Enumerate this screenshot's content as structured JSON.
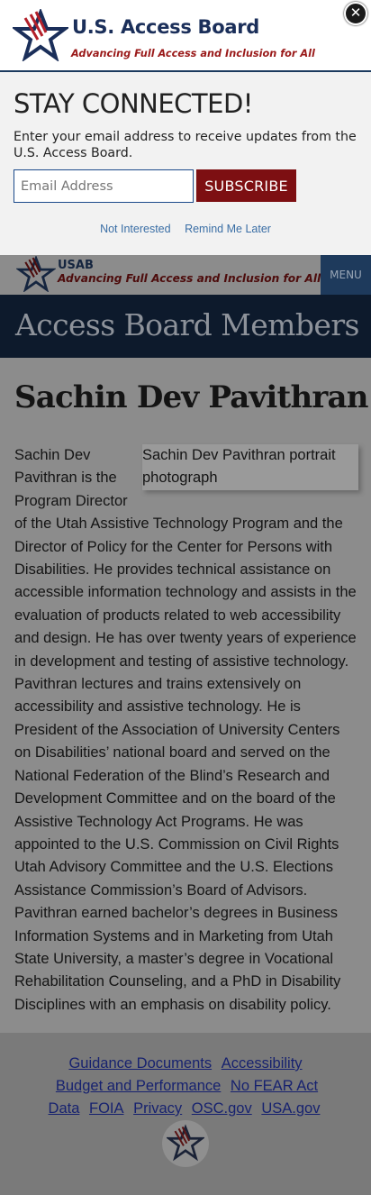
{
  "modal": {
    "brand": "U.S. Access Board",
    "tagline": "Advancing Full Access and Inclusion for All",
    "close_label": "✕",
    "title": "STAY CONNECTED!",
    "description": "Enter your email address to receive updates from the U.S. Access Board.",
    "email_placeholder": "Email Address",
    "subscribe_label": "SUBSCRIBE",
    "not_interested": "Not Interested",
    "remind_later": "Remind Me Later"
  },
  "header": {
    "short_name": "USAB",
    "tagline": "Advancing Full Access and Inclusion for All",
    "menu_label": "MENU"
  },
  "banner": {
    "title": "Access Board Members"
  },
  "member": {
    "name": "Sachin Dev Pavithran",
    "portrait_alt": "Sachin Dev Pavithran portrait photograph",
    "bio": "Sachin Dev Pavithran is the Program Director of the Utah Assistive Technology Program and the Director of Policy for the Center for Persons with Disabilities. He provides technical assistance on accessible information technology and assists in the evaluation of products related to web accessibility and design. He has over twenty years of experience in development and testing of assistive technology. Pavithran lectures and trains extensively on accessibility and assistive technology. He is President of the Association of University Centers on Disabilities’ national board and served on the National Federation of the Blind’s Research and Development Committee and on the board of the Assistive Technology Act Programs. He was appointed to the U.S. Commission on Civil Rights Utah Advisory Committee and the U.S. Elections Assistance Commission’s Board of Advisors. Pavithran earned bachelor’s degrees in Business Information Systems and in Marketing from Utah State University, a master’s degree in Vocational Rehabilitation Counseling, and a PhD in Disability Disciplines with an emphasis on disability policy."
  },
  "footer": {
    "links": [
      "Guidance Documents",
      "Accessibility",
      "Budget and Performance",
      "No FEAR Act Data",
      "FOIA",
      "Privacy",
      "OSC.gov",
      "USA.gov"
    ]
  },
  "colors": {
    "brand_navy": "#1b2f5a",
    "brand_red": "#9a1a1a",
    "subscribe_bg": "#7d0f12",
    "banner_bg": "#0d1a2c",
    "menu_bg": "#1e3a5c",
    "overlay": "#8c8c8c"
  },
  "icons": {
    "logo": "star-logo-icon",
    "close": "close-icon"
  }
}
